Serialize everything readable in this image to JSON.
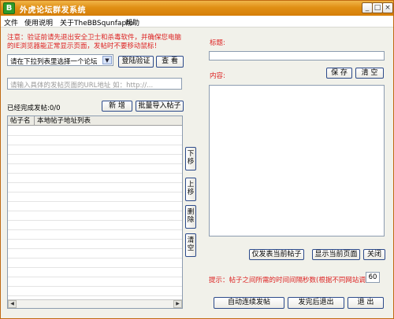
{
  "window": {
    "title": "外虎论坛群发系统",
    "icon_letter": "B",
    "controls": {
      "minimize": "_",
      "maximize": "□",
      "close": "×"
    }
  },
  "menu": [
    "文件",
    "使用说明",
    "关于TheBBSqunfapro",
    "帮助"
  ],
  "notice": "注意：验证前请先退出安全卫士和杀毒软件，并确保您电脑的IE浏览器能正常显示页面，发帖时不要移动鼠标！",
  "forum_select": {
    "selected": "请在下拉列表里选择一个论坛",
    "arrow_icon": "chevron-down-icon"
  },
  "buttons": {
    "login_verify": "登陆验证",
    "view": "查 看",
    "add": "新 增",
    "bulk_import": "批量导入帖子",
    "move_down": "下移",
    "move_up": "上移",
    "delete": "删除",
    "clear": "清空",
    "save": "保 存",
    "clear_content": "清 空",
    "post_to_current": "仅发表当前帖子",
    "show_current_page": "显示当前页面",
    "close": "关闭",
    "auto_post": "自动连续发帖",
    "post_finished_exit": "发完后退出",
    "exit": "退 出"
  },
  "url_input": {
    "placeholder": "请输入具体的发帖页面的URL地址 如：http://..."
  },
  "completed_label": "已经完成发帖:0/0",
  "table": {
    "columns": [
      "帖子名",
      "本地帖子地址列表"
    ],
    "rows": []
  },
  "right": {
    "title_label": "标题:",
    "title_value": "",
    "content_label": "内容:",
    "content_value": "",
    "tip": "提示：帖子之间所需的时间间隔秒数(根据不同网站调整)",
    "interval_value": "60"
  },
  "colors": {
    "titlebar": "#e08f14",
    "notice": "#dd2222",
    "button_border": "#2c4a8a"
  }
}
